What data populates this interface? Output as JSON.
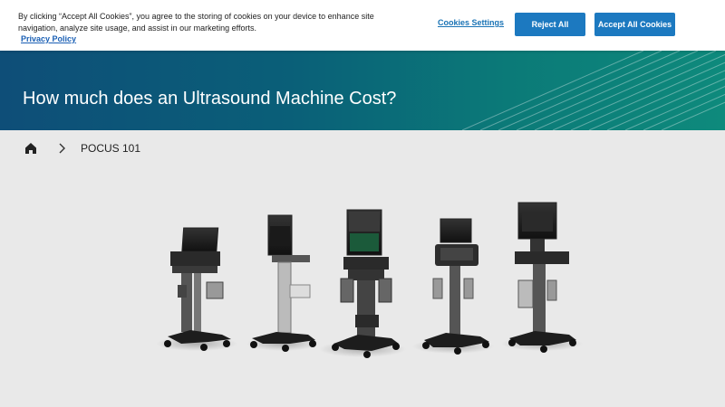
{
  "cookie_banner": {
    "text": "By clicking “Accept All Cookies”, you agree to the storing of cookies on your device to enhance site navigation, analyze site usage, and assist in our marketing efforts.",
    "privacy_link": "Privacy Policy",
    "settings_label": "Cookies Settings",
    "reject_label": "Reject All",
    "accept_label": "Accept All Cookies"
  },
  "hero": {
    "title": "How much does an Ultrasound Machine Cost?"
  },
  "breadcrumb": {
    "home_icon": "home-icon",
    "separator_icon": "chevron-right-icon",
    "current": "POCUS 101"
  },
  "colors": {
    "button_blue": "#1c79c0",
    "hero_start": "#0e4e78",
    "hero_end": "#0e8a7c",
    "page_bg": "#e9e9e9"
  }
}
